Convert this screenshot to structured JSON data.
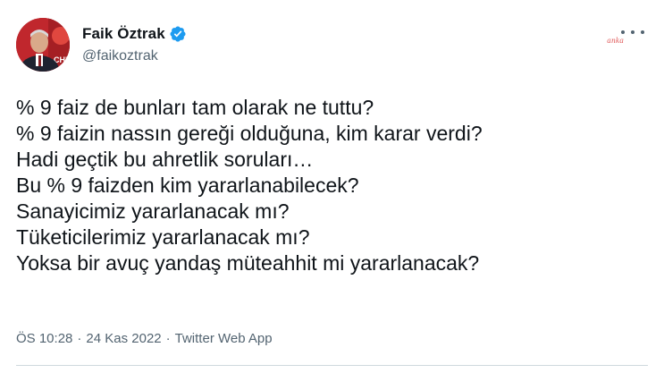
{
  "author": {
    "display_name": "Faik Öztrak",
    "handle": "@faikoztrak",
    "avatar_logo_text": "CHP"
  },
  "watermark": "anka",
  "tweet_lines": [
    "% 9 faiz de bunları tam olarak ne tuttu?",
    "% 9 faizin nassın gereği olduğuna, kim karar verdi?",
    "Hadi geçtik bu ahretlik soruları…",
    "Bu % 9 faizden kim yararlanabilecek?",
    "Sanayicimiz yararlanacak mı?",
    "Tüketicilerimiz yararlanacak mı?",
    "Yoksa bir avuç yandaş müteahhit mi yararlanacak?"
  ],
  "meta": {
    "time": "ÖS 10:28",
    "separator": "·",
    "date": "24 Kas 2022",
    "source": "Twitter Web App"
  },
  "colors": {
    "text": "#0f1419",
    "secondary": "#536471",
    "verified": "#1d9bf0",
    "divider": "#cfd9de",
    "watermark": "#e05a5a"
  },
  "icons": {
    "verified": "verified-badge-icon",
    "more": "more-options-icon"
  }
}
